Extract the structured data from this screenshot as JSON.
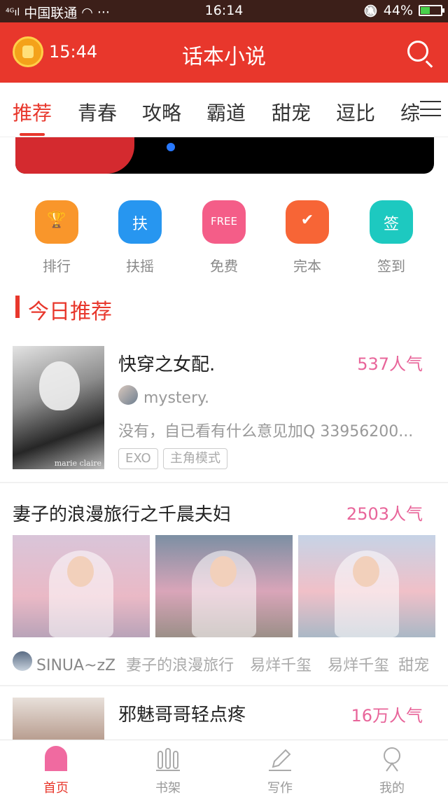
{
  "status_bar": {
    "carrier": "中国联通",
    "signal": "⁴ᴳıl",
    "wifi": "◠",
    "dots": "···",
    "time": "16:14",
    "bell": "🔕",
    "battery": "44%"
  },
  "header": {
    "time": "15:44",
    "title": "话本小说"
  },
  "tabs": [
    "推荐",
    "青春",
    "攻略",
    "霸道",
    "甜宠",
    "逗比",
    "综"
  ],
  "quick_actions": [
    {
      "label": "排行",
      "glyph": "🏆",
      "color": "#f9962b"
    },
    {
      "label": "扶摇",
      "glyph": "扶",
      "color": "#2796f0"
    },
    {
      "label": "免费",
      "glyph": "FREE",
      "color": "#f45d88"
    },
    {
      "label": "完本",
      "glyph": "✔",
      "color": "#f76536"
    },
    {
      "label": "签到",
      "glyph": "签",
      "color": "#1dc9c0"
    }
  ],
  "section": {
    "title": "今日推荐"
  },
  "card1": {
    "title": "快穿之女配.",
    "hot": "537人气",
    "author": "mystery.",
    "description": "没有，自已看有什么意见加Q 33956200...",
    "tags": [
      "EXO",
      "主角模式"
    ],
    "cover_caption": "marie claire"
  },
  "card2": {
    "title": "妻子的浪漫旅行之千晨夫妇",
    "hot": "2503人气",
    "author": "SINUA~zZ",
    "tags": [
      "妻子的浪漫旅行",
      "易烊千玺",
      "易烊千玺",
      "甜宠"
    ]
  },
  "card3": {
    "title": "邪魅哥哥轻点疼",
    "hot": "16万人气"
  },
  "bottom_nav": [
    {
      "label": "首页",
      "icon": "home-icon",
      "active": true
    },
    {
      "label": "书架",
      "icon": "bookshelf-icon",
      "active": false
    },
    {
      "label": "写作",
      "icon": "pen-icon",
      "active": false
    },
    {
      "label": "我的",
      "icon": "profile-icon",
      "active": false
    }
  ],
  "colors": {
    "accent": "#e8372c",
    "popularity": "#e8659a"
  }
}
